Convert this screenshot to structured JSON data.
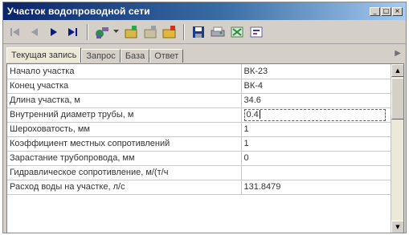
{
  "window": {
    "title": "Участок водопроводной сети",
    "controls": [
      "minimize-icon",
      "maximize-icon",
      "close-icon"
    ]
  },
  "toolbar": {
    "buttons": [
      "first-record-icon",
      "prev-record-icon",
      "next-record-icon",
      "last-record-icon",
      "pipe-tool-icon",
      "new-record-icon",
      "edit-record-icon",
      "open-folder-icon",
      "save-icon",
      "print-icon",
      "network-icon",
      "report-icon"
    ]
  },
  "tabs": [
    {
      "label": "Текущая запись",
      "active": true
    },
    {
      "label": "Запрос",
      "active": false
    },
    {
      "label": "База",
      "active": false
    },
    {
      "label": "Ответ",
      "active": false
    }
  ],
  "grid": {
    "rows": [
      {
        "name": "Начало участка",
        "value": "ВК-23"
      },
      {
        "name": "Конец участка",
        "value": "ВК-4"
      },
      {
        "name": "Длина участка, м",
        "value": "34.6"
      },
      {
        "name": "Внутренний диаметр трубы, м",
        "value": "0.4",
        "editing": true
      },
      {
        "name": "Шероховатость, мм",
        "value": "1"
      },
      {
        "name": "Коэффициент местных сопротивлений",
        "value": "1"
      },
      {
        "name": "Зарастание трубопровода, мм",
        "value": "0"
      },
      {
        "name": "Гидравлическое сопротивление, м/(т/ч",
        "value": ""
      },
      {
        "name": "Расход воды на участке, л/с",
        "value": "131.8479"
      }
    ]
  },
  "colors": {
    "title_gradient_start": "#0a246a",
    "title_gradient_end": "#a6caf0",
    "window_face": "#d4d0c8"
  }
}
